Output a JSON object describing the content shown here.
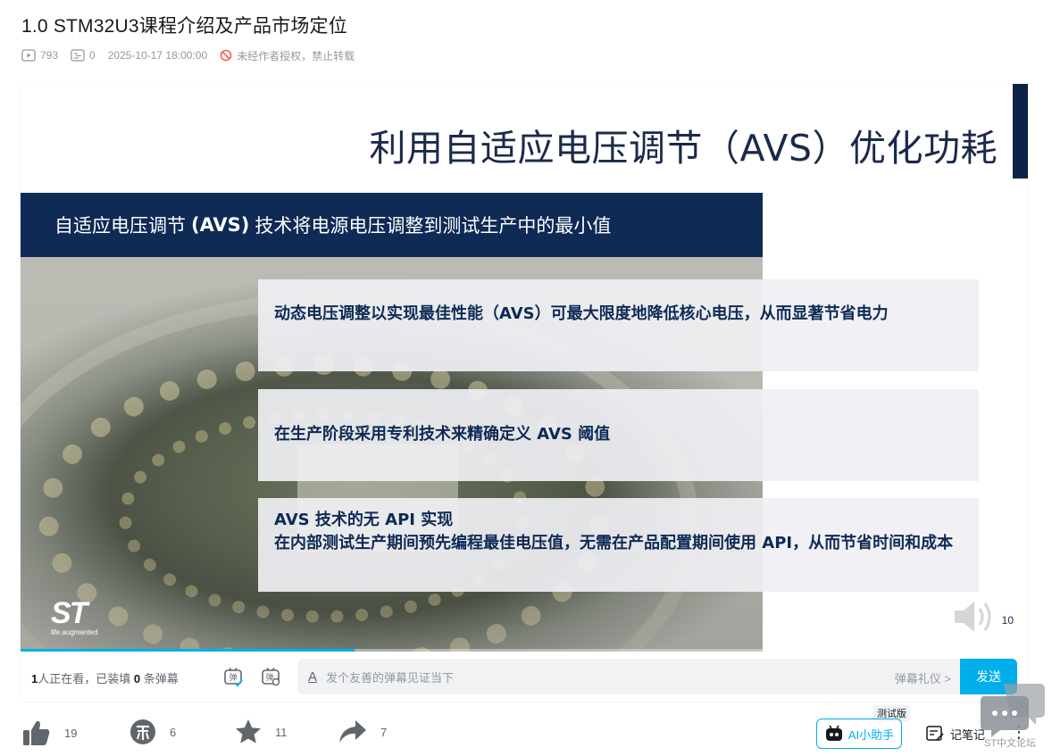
{
  "video": {
    "title": "1.0 STM32U3课程介绍及产品市场定位",
    "views": "793",
    "danmaku_count": "0",
    "publish_time": "2025-10-17 18:00:00",
    "copyright": "未经作者授权，禁止转载"
  },
  "slide": {
    "title": "利用自适应电压调节（AVS）优化功耗",
    "banner_pre": "自适应电压调节",
    "banner_bold": "(AVS)",
    "banner_post": "技术将电源电压调整到测试生产中的最小值",
    "callout1": "动态电压调整以实现最佳性能（AVS）可最大限度地降低核心电压，从而显著节省电力",
    "callout2": "在生产阶段采用专利技术来精确定义 AVS 阈值",
    "callout3_line1": "AVS 技术的无 API 实现",
    "callout3_line2": "在内部测试生产期间预先编程最佳电压值，无需在产品配置期间使用 API，从而节省时间和成本",
    "logo_sub": "life.augmented",
    "page_number": "10",
    "progress_fraction": 0.45
  },
  "danmaku": {
    "viewers_count": "1",
    "viewers_text_a": "人正在看，已装填 ",
    "danmaku_loaded": "0",
    "viewers_text_b": " 条弹幕",
    "placeholder": "发个友善的弹幕见证当下",
    "etiquette": "弹幕礼仪 >",
    "send": "发送"
  },
  "actions": {
    "like": "19",
    "coin": "6",
    "favorite": "11",
    "share": "7",
    "ai_assistant": "AI小助手",
    "beta": "测试版",
    "notes": "记笔记"
  },
  "forum": {
    "label": "ST中文论坛"
  },
  "colors": {
    "accent": "#00aeec",
    "navy": "#0e2a55",
    "text_muted": "#9499a0"
  }
}
